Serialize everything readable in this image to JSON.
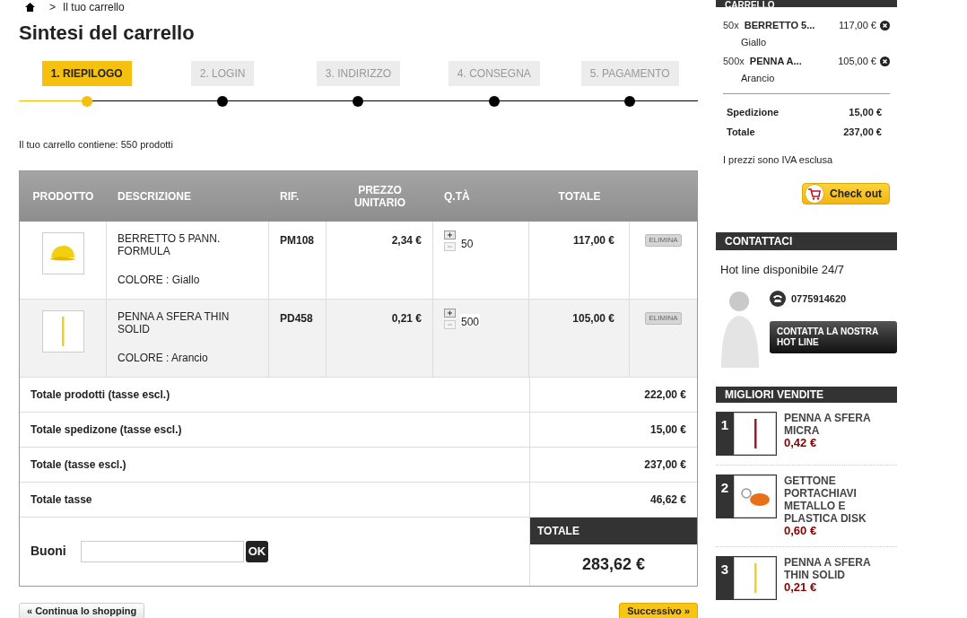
{
  "breadcrumb": {
    "separator": ">",
    "current": "Il tuo carrello"
  },
  "title": "Sintesi del carrello",
  "steps": [
    {
      "label": "1. RIEPILOGO",
      "selected": true
    },
    {
      "label": "2. LOGIN",
      "selected": false
    },
    {
      "label": "3. INDIRIZZO",
      "selected": false
    },
    {
      "label": "4. CONSEGNA",
      "selected": false
    },
    {
      "label": "5. PAGAMENTO",
      "selected": false
    }
  ],
  "cart_count": "Il tuo carrello contiene: 550 prodotti",
  "table": {
    "columns": [
      "PRODOTTO",
      "DESCRIZIONE",
      "RIF.",
      "PREZZO UNITARIO",
      "Q.TÀ",
      "TOTALE"
    ],
    "rows": [
      {
        "kind": "cap",
        "name": "BERRETTO 5 PANN. FORMULA",
        "color_label": "COLORE : Giallo",
        "ref": "PM108",
        "unit_price": "2,34 €",
        "qty": "50",
        "total": "117,00 €",
        "delete": "ELIMINA"
      },
      {
        "kind": "pen",
        "name": "PENNA A SFERA THIN SOLID",
        "color_label": "COLORE : Arancio",
        "ref": "PD458",
        "unit_price": "0,21 €",
        "qty": "500",
        "total": "105,00 €",
        "delete": "ELIMINA"
      }
    ],
    "totals": [
      {
        "label": "Totale prodotti (tasse escl.)",
        "value": "222,00 €"
      },
      {
        "label": "Totale spedizone (tasse escl.)",
        "value": "15,00 €"
      },
      {
        "label": "Totale (tasse escl.)",
        "value": "237,00 €"
      },
      {
        "label": "Totale tasse",
        "value": "46,62 €"
      }
    ],
    "voucher": {
      "label": "Buoni",
      "button": "OK"
    },
    "grand_total": {
      "label": "TOTALE",
      "value": "283,62 €"
    }
  },
  "buttons": {
    "back": "« Continua lo shopping",
    "next": "Successivo »"
  },
  "sidebar": {
    "cart": {
      "title": "CARRELLO",
      "items": [
        {
          "qty": "50x",
          "name": "BERRETTO 5...",
          "price": "117,00 €",
          "variant": "Giallo"
        },
        {
          "qty": "500x",
          "name": "PENNA A...",
          "price": "105,00 €",
          "variant": "Arancio"
        }
      ],
      "summary": [
        {
          "label": "Spedizione",
          "value": "15,00 €"
        },
        {
          "label": "Totale",
          "value": "237,00 €"
        }
      ],
      "note": "I prezzi sono IVA esclusa",
      "checkout": "Check out"
    },
    "contact": {
      "title": "CONTATTACI",
      "hotline": "Hot line disponibile 24/7",
      "phone": "0775914620",
      "button": "CONTATTA LA NOSTRA HOT LINE"
    },
    "bestsellers": {
      "title": "MIGLIORI VENDITE",
      "items": [
        {
          "rank": "1",
          "kind": "pen",
          "color": "#a0182c",
          "name": "PENNA A SFERA MICRA",
          "price": "0,42 €"
        },
        {
          "rank": "2",
          "kind": "keychain",
          "color": "#e8701a",
          "name": "GETTONE PORTACHIAVI METALLO E PLASTICA DISK",
          "price": "0,60 €"
        },
        {
          "rank": "3",
          "kind": "pen",
          "color": "#f0d020",
          "name": "PENNA A SFERA THIN SOLID",
          "price": "0,21 €"
        }
      ]
    }
  }
}
